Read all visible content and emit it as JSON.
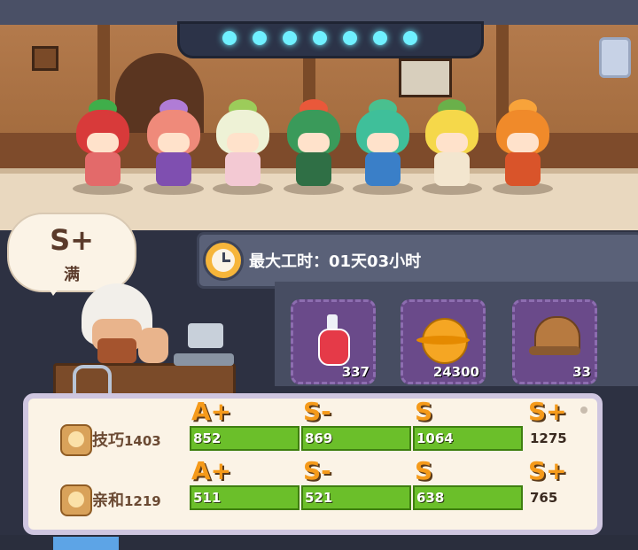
{
  "speech_bubble": {
    "grade": "S+",
    "status": "满"
  },
  "work_time": {
    "text": "最大工时：01天03小时"
  },
  "materials": [
    {
      "icon": "potion-icon",
      "count": "337"
    },
    {
      "icon": "planet-icon",
      "count": "24300"
    },
    {
      "icon": "helmet-icon",
      "count": "33"
    }
  ],
  "stats": [
    {
      "label": "技巧",
      "value": "1403",
      "grades": [
        "A+",
        "S-",
        "S",
        "S+"
      ],
      "thresholds": [
        "852",
        "869",
        "1064",
        "1275"
      ],
      "progress_segments_filled": 3
    },
    {
      "label": "亲和",
      "value": "1219",
      "grades": [
        "A+",
        "S-",
        "S",
        "S+"
      ],
      "thresholds": [
        "511",
        "521",
        "638",
        "765"
      ],
      "progress_segments_filled": 3
    }
  ],
  "colors": {
    "accent_orange": "#f59a1a",
    "bar_green": "#6bbf2a",
    "lamp_cyan": "#6ff0ff",
    "material_slot": "#6a4a8a"
  }
}
